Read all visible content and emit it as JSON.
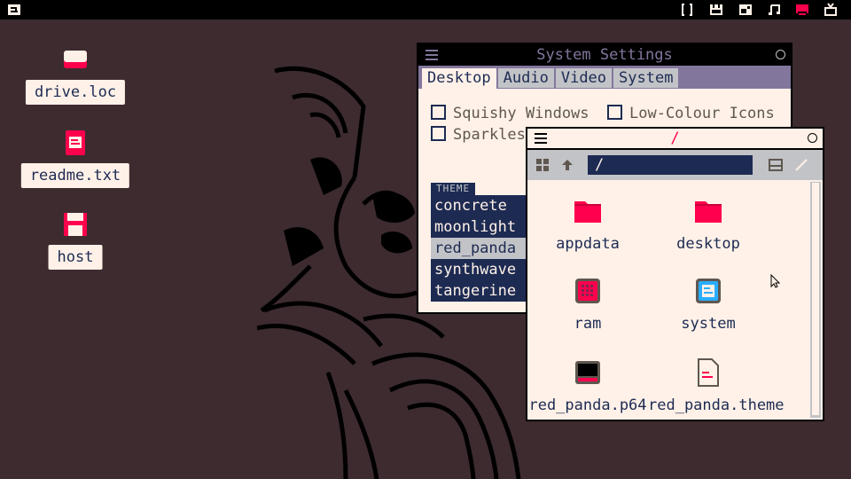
{
  "colors": {
    "background": "#3d2b30",
    "accent": "#ff004d",
    "navy": "#1d2b53",
    "cream": "#fff1e8",
    "grey": "#c2c3c7",
    "lavender": "#83769c"
  },
  "topbar": {
    "logo_icon": "system-logo-icon",
    "tray_icons": [
      "braces-icon",
      "cat-icon",
      "window-icon",
      "music-icon",
      "red-window-icon",
      "tv-icon"
    ]
  },
  "desktop": {
    "icons": [
      {
        "label": "drive.loc",
        "icon": "drive-icon"
      },
      {
        "label": "readme.txt",
        "icon": "document-icon"
      },
      {
        "label": "host",
        "icon": "floppy-icon"
      }
    ]
  },
  "settings": {
    "title": "System Settings",
    "tabs": [
      "Desktop",
      "Audio",
      "Video",
      "System"
    ],
    "checkboxes": [
      "Squishy Windows",
      "Low-Colour Icons",
      "Sparkles"
    ],
    "theme_label": "THEME",
    "themes": [
      "concrete",
      "moonlight",
      "red_panda",
      "synthwave",
      "tangerine"
    ],
    "selected_theme": "red_panda"
  },
  "files": {
    "title": "/",
    "path": "/",
    "items": [
      {
        "label": "appdata",
        "icon": "folder-icon"
      },
      {
        "label": "desktop",
        "icon": "folder-icon"
      },
      {
        "label": "ram",
        "icon": "ram-icon"
      },
      {
        "label": "system",
        "icon": "system-icon"
      },
      {
        "label": "red_panda.p64",
        "icon": "cartridge-icon"
      },
      {
        "label": "red_panda.theme",
        "icon": "file-icon"
      }
    ]
  }
}
